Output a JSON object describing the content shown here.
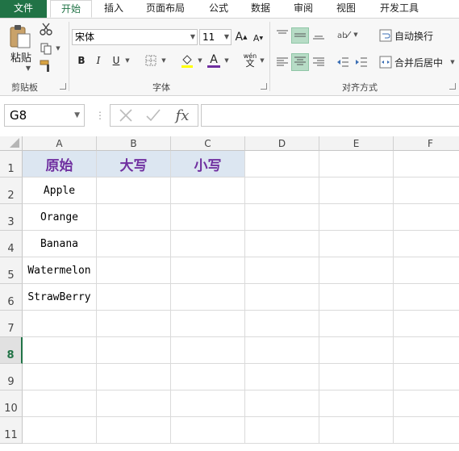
{
  "tabs": [
    {
      "label": "文件"
    },
    {
      "label": "开始"
    },
    {
      "label": "插入"
    },
    {
      "label": "页面布局"
    },
    {
      "label": "公式"
    },
    {
      "label": "数据"
    },
    {
      "label": "审阅"
    },
    {
      "label": "视图"
    },
    {
      "label": "开发工具"
    }
  ],
  "ribbon": {
    "clipboard": {
      "paste_label": "粘贴",
      "group_label": "剪贴板"
    },
    "font": {
      "font_name": "宋体",
      "font_size": "11",
      "group_label": "字体",
      "bold": "B",
      "italic": "I",
      "underline": "U",
      "font_color_letter": "A",
      "wen": "wén"
    },
    "alignment": {
      "wrap_text": "自动换行",
      "merge_center": "合并后居中",
      "group_label": "对齐方式"
    }
  },
  "formula_bar": {
    "name_box": "G8",
    "fx": "fx",
    "formula": ""
  },
  "columns": [
    "A",
    "B",
    "C",
    "D",
    "E",
    "F"
  ],
  "rows": [
    "1",
    "2",
    "3",
    "4",
    "5",
    "6",
    "7",
    "8",
    "9",
    "10",
    "11"
  ],
  "table": {
    "headers": [
      "原始",
      "大写",
      "小写"
    ],
    "values": [
      "Apple",
      "Orange",
      "Banana",
      "Watermelon",
      "StrawBerry"
    ]
  },
  "colors": {
    "accent": "#217346",
    "header_fill": "#dce6f1",
    "header_text": "#7030a0",
    "font_color_bar": "#7030a0"
  }
}
